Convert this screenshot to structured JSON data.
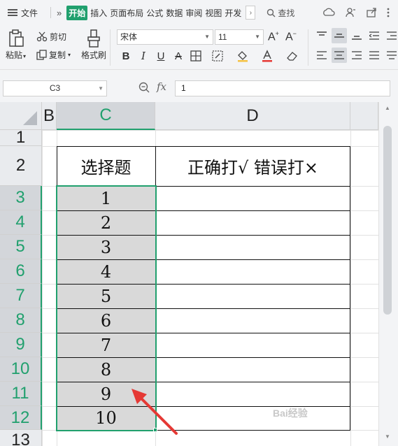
{
  "menubar": {
    "file_label": "文件",
    "tabs": [
      "开始",
      "插入",
      "页面布局",
      "公式",
      "数据",
      "审阅",
      "视图",
      "开发"
    ],
    "active_tab": "开始",
    "search_label": "查找"
  },
  "ribbon": {
    "paste_label": "粘贴",
    "cut_label": "剪切",
    "copy_label": "复制",
    "format_painter_label": "格式刷",
    "font_name": "宋体",
    "font_size": "11",
    "bold": "B",
    "italic": "I",
    "underline": "U",
    "strike": "A"
  },
  "formula_bar": {
    "cell_ref": "C3",
    "fx_label": "fx",
    "value": "1"
  },
  "sheet": {
    "columns": [
      "B",
      "C",
      "D"
    ],
    "selected_column": "C",
    "rows": [
      "1",
      "2",
      "3",
      "4",
      "5",
      "6",
      "7",
      "8",
      "9",
      "10",
      "11",
      "12",
      "13"
    ],
    "header_c": "选择题",
    "header_d": "正确打√ 错误打×",
    "values": [
      "1",
      "2",
      "3",
      "4",
      "5",
      "6",
      "7",
      "8",
      "9",
      "10"
    ]
  },
  "colors": {
    "accent": "#21a06e",
    "annotation_arrow": "#e53935"
  },
  "watermark": "Bai经验"
}
